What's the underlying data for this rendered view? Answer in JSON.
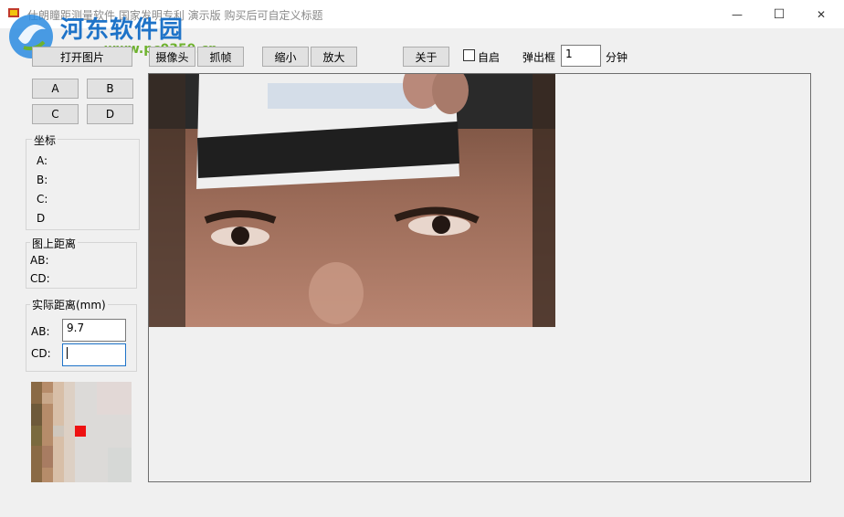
{
  "window": {
    "title": "仕朗瞳距测量软件 国家发明专利 演示版 购买后可自定义标题",
    "watermark_name": "河东软件园",
    "watermark_url": "www.pc0359.cn",
    "minimize_glyph": "—",
    "maximize_glyph": "☐",
    "close_glyph": "✕"
  },
  "toolbar": {
    "open_image": "打开图片",
    "camera": "摄像头",
    "capture": "抓帧",
    "zoom_out": "缩小",
    "zoom_in": "放大",
    "about": "关于",
    "auto_start_label": "自启",
    "popup_label": "弹出框",
    "popup_value": "1",
    "minutes_label": "分钟"
  },
  "points": {
    "a": "A",
    "b": "B",
    "c": "C",
    "d": "D"
  },
  "coords": {
    "legend": "坐标",
    "a": "A:",
    "b": "B:",
    "c": "C:",
    "d": "D"
  },
  "image_distance": {
    "legend": "图上距离",
    "ab": "AB:",
    "cd": "CD:"
  },
  "real_distance": {
    "legend": "实际距离(mm)",
    "ab_label": "AB:",
    "ab_value": "9.7",
    "cd_label": "CD:",
    "cd_value": ""
  },
  "colors": {
    "marker": "#ee1111",
    "watermark_blue": "#1e73c8",
    "watermark_green": "#6eb22e"
  }
}
